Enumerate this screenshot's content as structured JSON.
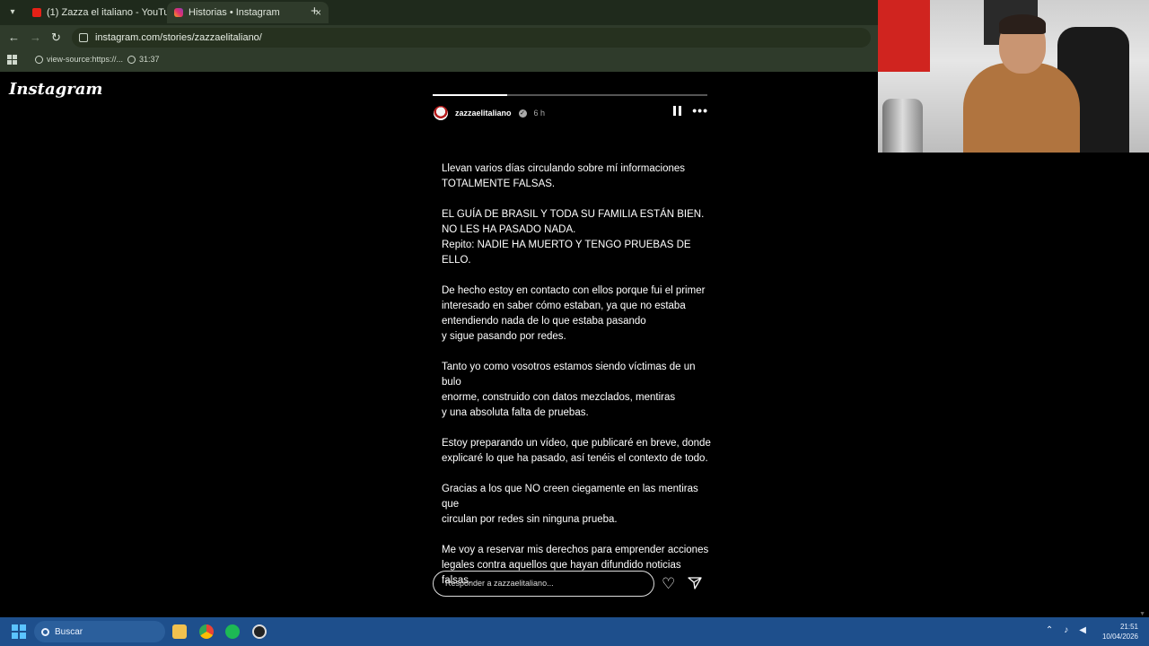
{
  "browser": {
    "tabs": [
      {
        "title": "(1) Zazza el italiano - YouTube",
        "active": false,
        "icon": "youtube-icon"
      },
      {
        "title": "Historias • Instagram",
        "active": true,
        "icon": "instagram-icon"
      }
    ],
    "close_glyph": "×",
    "new_tab_glyph": "+",
    "url": "instagram.com/stories/zazzaelitaliano/",
    "bookmarks": [
      {
        "label": "view-source:https://...",
        "icon": "globe-icon"
      },
      {
        "label": "31:37",
        "icon": "clock-icon"
      }
    ]
  },
  "page": {
    "logo": "Instagram",
    "story": {
      "progress_fraction": 0.27,
      "username": "zazzaelitaliano",
      "verified_glyph": "✓",
      "age": "6 h",
      "more_glyph": "•••",
      "paragraphs": [
        "Llevan varios días circulando sobre mí informaciones\nTOTALMENTE FALSAS.",
        "EL GUÍA DE BRASIL Y TODA SU FAMILIA ESTÁN BIEN.\nNO LES HA PASADO NADA.\nRepito: NADIE HA MUERTO Y TENGO PRUEBAS DE ELLO.",
        "De hecho estoy en contacto con ellos porque fui el primer\ninteresado en saber cómo estaban, ya que no estaba\nentendiendo nada de lo que estaba pasando\ny sigue pasando por redes.",
        "Tanto yo como vosotros estamos siendo víctimas de un bulo\nenorme, construido con datos mezclados, mentiras\ny una absoluta falta de pruebas.",
        "Estoy preparando un vídeo, que publicaré en breve, donde\nexplicaré lo que ha pasado, así tenéis el contexto de todo.",
        "Gracias a los que NO creen ciegamente en las mentiras que\ncirculan por redes sin ninguna prueba.",
        "Me voy a reservar mis derechos para emprender acciones\nlegales contra aquellos que hayan difundido noticias falsas."
      ],
      "reply_placeholder": "Responder a zazzaelitaliano...",
      "heart_glyph": "♡"
    }
  },
  "taskbar": {
    "search_label": "Buscar",
    "time": "21:51",
    "date": "10/04/2026"
  }
}
